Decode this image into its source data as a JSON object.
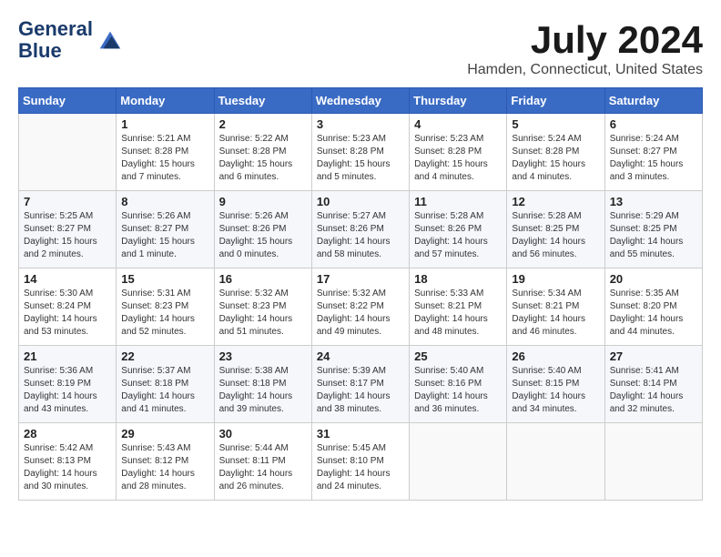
{
  "header": {
    "logo_line1": "General",
    "logo_line2": "Blue",
    "month_title": "July 2024",
    "location": "Hamden, Connecticut, United States"
  },
  "weekdays": [
    "Sunday",
    "Monday",
    "Tuesday",
    "Wednesday",
    "Thursday",
    "Friday",
    "Saturday"
  ],
  "weeks": [
    [
      {
        "day": "",
        "info": ""
      },
      {
        "day": "1",
        "info": "Sunrise: 5:21 AM\nSunset: 8:28 PM\nDaylight: 15 hours\nand 7 minutes."
      },
      {
        "day": "2",
        "info": "Sunrise: 5:22 AM\nSunset: 8:28 PM\nDaylight: 15 hours\nand 6 minutes."
      },
      {
        "day": "3",
        "info": "Sunrise: 5:23 AM\nSunset: 8:28 PM\nDaylight: 15 hours\nand 5 minutes."
      },
      {
        "day": "4",
        "info": "Sunrise: 5:23 AM\nSunset: 8:28 PM\nDaylight: 15 hours\nand 4 minutes."
      },
      {
        "day": "5",
        "info": "Sunrise: 5:24 AM\nSunset: 8:28 PM\nDaylight: 15 hours\nand 4 minutes."
      },
      {
        "day": "6",
        "info": "Sunrise: 5:24 AM\nSunset: 8:27 PM\nDaylight: 15 hours\nand 3 minutes."
      }
    ],
    [
      {
        "day": "7",
        "info": "Sunrise: 5:25 AM\nSunset: 8:27 PM\nDaylight: 15 hours\nand 2 minutes."
      },
      {
        "day": "8",
        "info": "Sunrise: 5:26 AM\nSunset: 8:27 PM\nDaylight: 15 hours\nand 1 minute."
      },
      {
        "day": "9",
        "info": "Sunrise: 5:26 AM\nSunset: 8:26 PM\nDaylight: 15 hours\nand 0 minutes."
      },
      {
        "day": "10",
        "info": "Sunrise: 5:27 AM\nSunset: 8:26 PM\nDaylight: 14 hours\nand 58 minutes."
      },
      {
        "day": "11",
        "info": "Sunrise: 5:28 AM\nSunset: 8:26 PM\nDaylight: 14 hours\nand 57 minutes."
      },
      {
        "day": "12",
        "info": "Sunrise: 5:28 AM\nSunset: 8:25 PM\nDaylight: 14 hours\nand 56 minutes."
      },
      {
        "day": "13",
        "info": "Sunrise: 5:29 AM\nSunset: 8:25 PM\nDaylight: 14 hours\nand 55 minutes."
      }
    ],
    [
      {
        "day": "14",
        "info": "Sunrise: 5:30 AM\nSunset: 8:24 PM\nDaylight: 14 hours\nand 53 minutes."
      },
      {
        "day": "15",
        "info": "Sunrise: 5:31 AM\nSunset: 8:23 PM\nDaylight: 14 hours\nand 52 minutes."
      },
      {
        "day": "16",
        "info": "Sunrise: 5:32 AM\nSunset: 8:23 PM\nDaylight: 14 hours\nand 51 minutes."
      },
      {
        "day": "17",
        "info": "Sunrise: 5:32 AM\nSunset: 8:22 PM\nDaylight: 14 hours\nand 49 minutes."
      },
      {
        "day": "18",
        "info": "Sunrise: 5:33 AM\nSunset: 8:21 PM\nDaylight: 14 hours\nand 48 minutes."
      },
      {
        "day": "19",
        "info": "Sunrise: 5:34 AM\nSunset: 8:21 PM\nDaylight: 14 hours\nand 46 minutes."
      },
      {
        "day": "20",
        "info": "Sunrise: 5:35 AM\nSunset: 8:20 PM\nDaylight: 14 hours\nand 44 minutes."
      }
    ],
    [
      {
        "day": "21",
        "info": "Sunrise: 5:36 AM\nSunset: 8:19 PM\nDaylight: 14 hours\nand 43 minutes."
      },
      {
        "day": "22",
        "info": "Sunrise: 5:37 AM\nSunset: 8:18 PM\nDaylight: 14 hours\nand 41 minutes."
      },
      {
        "day": "23",
        "info": "Sunrise: 5:38 AM\nSunset: 8:18 PM\nDaylight: 14 hours\nand 39 minutes."
      },
      {
        "day": "24",
        "info": "Sunrise: 5:39 AM\nSunset: 8:17 PM\nDaylight: 14 hours\nand 38 minutes."
      },
      {
        "day": "25",
        "info": "Sunrise: 5:40 AM\nSunset: 8:16 PM\nDaylight: 14 hours\nand 36 minutes."
      },
      {
        "day": "26",
        "info": "Sunrise: 5:40 AM\nSunset: 8:15 PM\nDaylight: 14 hours\nand 34 minutes."
      },
      {
        "day": "27",
        "info": "Sunrise: 5:41 AM\nSunset: 8:14 PM\nDaylight: 14 hours\nand 32 minutes."
      }
    ],
    [
      {
        "day": "28",
        "info": "Sunrise: 5:42 AM\nSunset: 8:13 PM\nDaylight: 14 hours\nand 30 minutes."
      },
      {
        "day": "29",
        "info": "Sunrise: 5:43 AM\nSunset: 8:12 PM\nDaylight: 14 hours\nand 28 minutes."
      },
      {
        "day": "30",
        "info": "Sunrise: 5:44 AM\nSunset: 8:11 PM\nDaylight: 14 hours\nand 26 minutes."
      },
      {
        "day": "31",
        "info": "Sunrise: 5:45 AM\nSunset: 8:10 PM\nDaylight: 14 hours\nand 24 minutes."
      },
      {
        "day": "",
        "info": ""
      },
      {
        "day": "",
        "info": ""
      },
      {
        "day": "",
        "info": ""
      }
    ]
  ]
}
